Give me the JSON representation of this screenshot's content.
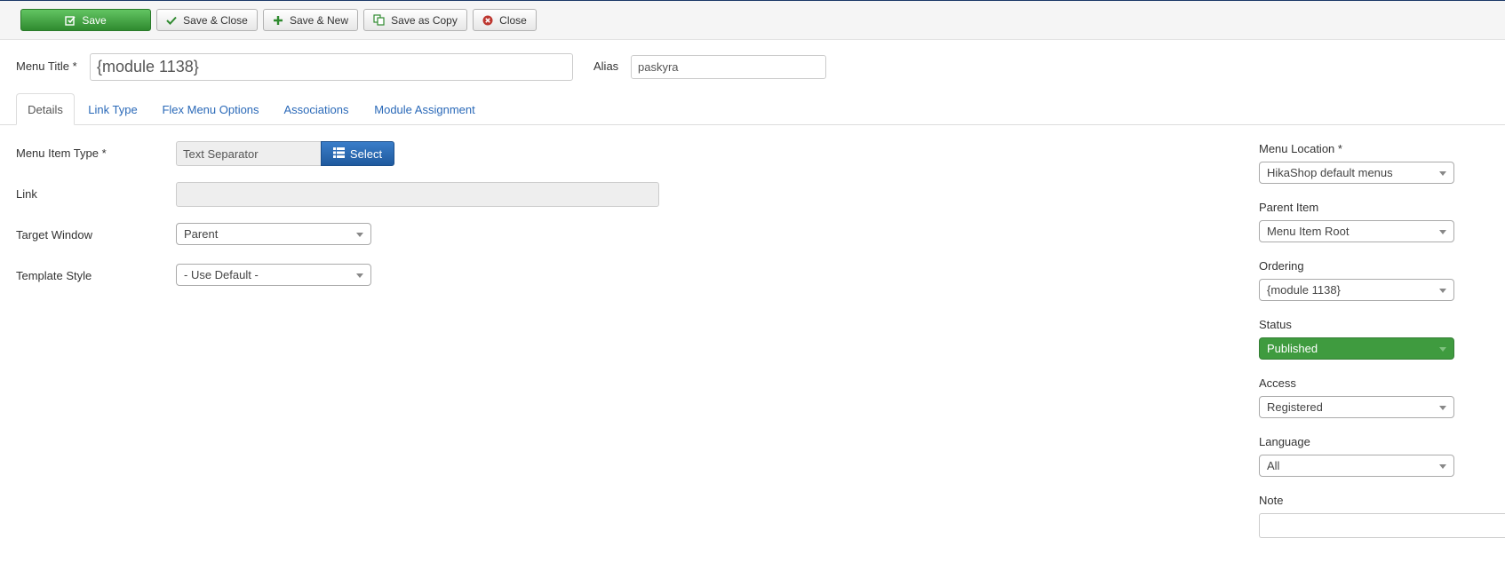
{
  "toolbar": {
    "save": "Save",
    "save_close": "Save & Close",
    "save_new": "Save & New",
    "save_copy": "Save as Copy",
    "close": "Close"
  },
  "header": {
    "title_label": "Menu Title *",
    "title_value": "{module 1138}",
    "alias_label": "Alias",
    "alias_value": "paskyra"
  },
  "tabs": [
    "Details",
    "Link Type",
    "Flex Menu Options",
    "Associations",
    "Module Assignment"
  ],
  "details": {
    "type_label": "Menu Item Type *",
    "type_value": "Text Separator",
    "select_button": "Select",
    "link_label": "Link",
    "link_value": "",
    "target_label": "Target Window",
    "target_value": "Parent",
    "template_label": "Template Style",
    "template_value": "- Use Default -"
  },
  "sidebar": {
    "location_label": "Menu Location *",
    "location_value": "HikaShop default menus",
    "parent_label": "Parent Item",
    "parent_value": "Menu Item Root",
    "ordering_label": "Ordering",
    "ordering_value": "{module 1138}",
    "status_label": "Status",
    "status_value": "Published",
    "access_label": "Access",
    "access_value": "Registered",
    "language_label": "Language",
    "language_value": "All",
    "note_label": "Note",
    "note_value": ""
  },
  "colors": {
    "success": "#3f9b3f",
    "primary": "#2a69b8",
    "link": "#2a69b8"
  },
  "icons": {
    "save": "check-edit-icon",
    "save_close": "check-icon",
    "save_new": "plus-icon",
    "save_copy": "copy-icon",
    "close": "cancel-circle-icon",
    "select": "list-icon"
  }
}
